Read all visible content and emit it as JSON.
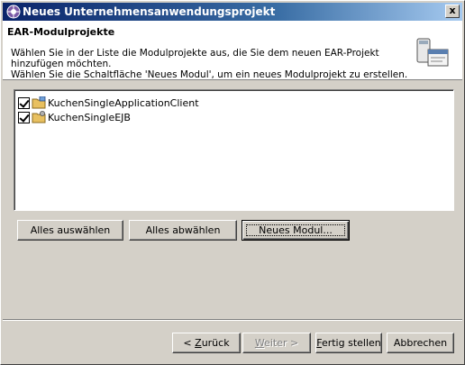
{
  "window": {
    "title": "Neues Unternehmensanwendungsprojekt",
    "close_label": "x"
  },
  "header": {
    "title": "EAR-Modulprojekte",
    "description_line1": "Wählen Sie in der Liste die Modulprojekte aus, die Sie dem neuen EAR-Projekt hinzufügen möchten.",
    "description_line2": "Wählen Sie die Schaltfläche 'Neues Modul', um ein neues Modulprojekt zu erstellen."
  },
  "modules": [
    {
      "label": "KuchenSingleApplicationClient",
      "checked": true
    },
    {
      "label": "KuchenSingleEJB",
      "checked": true
    }
  ],
  "actions": {
    "select_all": "Alles auswählen",
    "deselect_all": "Alles abwählen",
    "new_module": "Neues Modul..."
  },
  "footer": {
    "back_prefix": "< ",
    "back_mnemonic": "Z",
    "back_rest": "urück",
    "next_mnemonic": "W",
    "next_rest": "eiter >",
    "finish_mnemonic": "F",
    "finish_rest": "ertig stellen",
    "cancel": "Abbrechen"
  }
}
